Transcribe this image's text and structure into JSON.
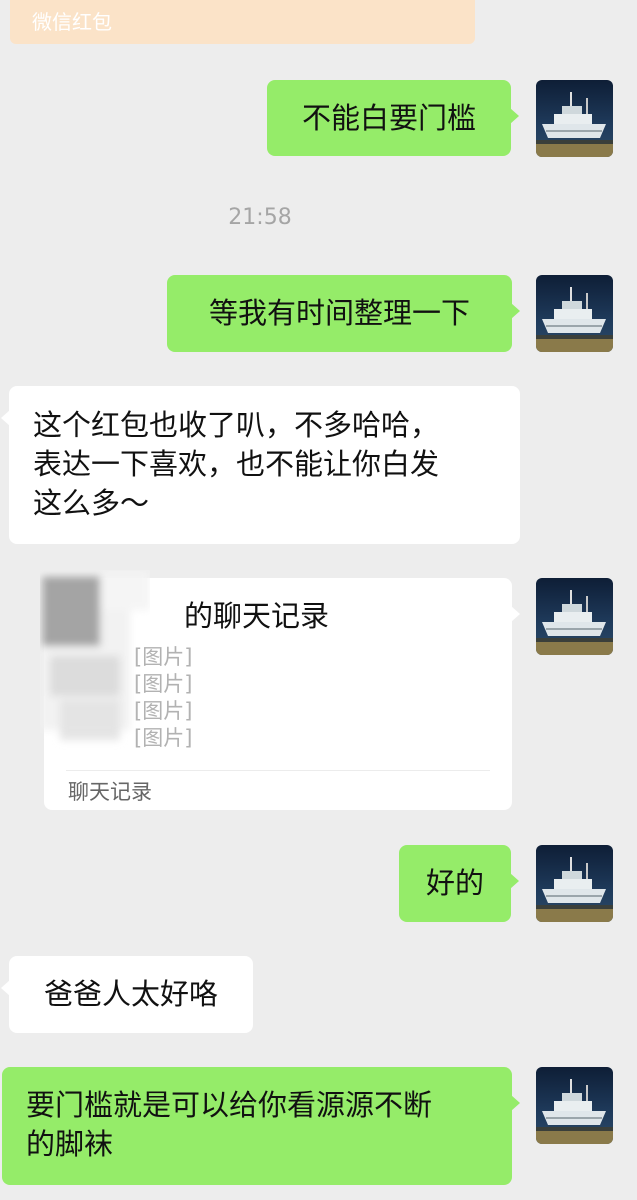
{
  "redpacket_footer": {
    "label": "微信红包"
  },
  "timestamp": "21:58",
  "messages": {
    "m1": "不能白要门槛",
    "m2": "等我有时间整理一下",
    "m3_lines": [
      "这个红包也收了叭，不多哈哈，",
      "表达一下喜欢，也不能让你白发",
      "这么多～"
    ],
    "m5": "好的",
    "m6": "爸爸人太好咯",
    "m7_lines": [
      "要门槛就是可以给你看源源不断",
      "的脚袜"
    ]
  },
  "chat_record": {
    "title": "的聊天记录",
    "lines": [
      "[图片]",
      "[图片]",
      "[图片]",
      "[图片]"
    ],
    "footer": "聊天记录"
  },
  "colors": {
    "background": "#ededed",
    "self_bubble": "#95ec69",
    "other_bubble": "#ffffff",
    "timestamp_text": "#a5a5a5"
  },
  "icons": {
    "avatar": "ship-photo-avatar"
  }
}
